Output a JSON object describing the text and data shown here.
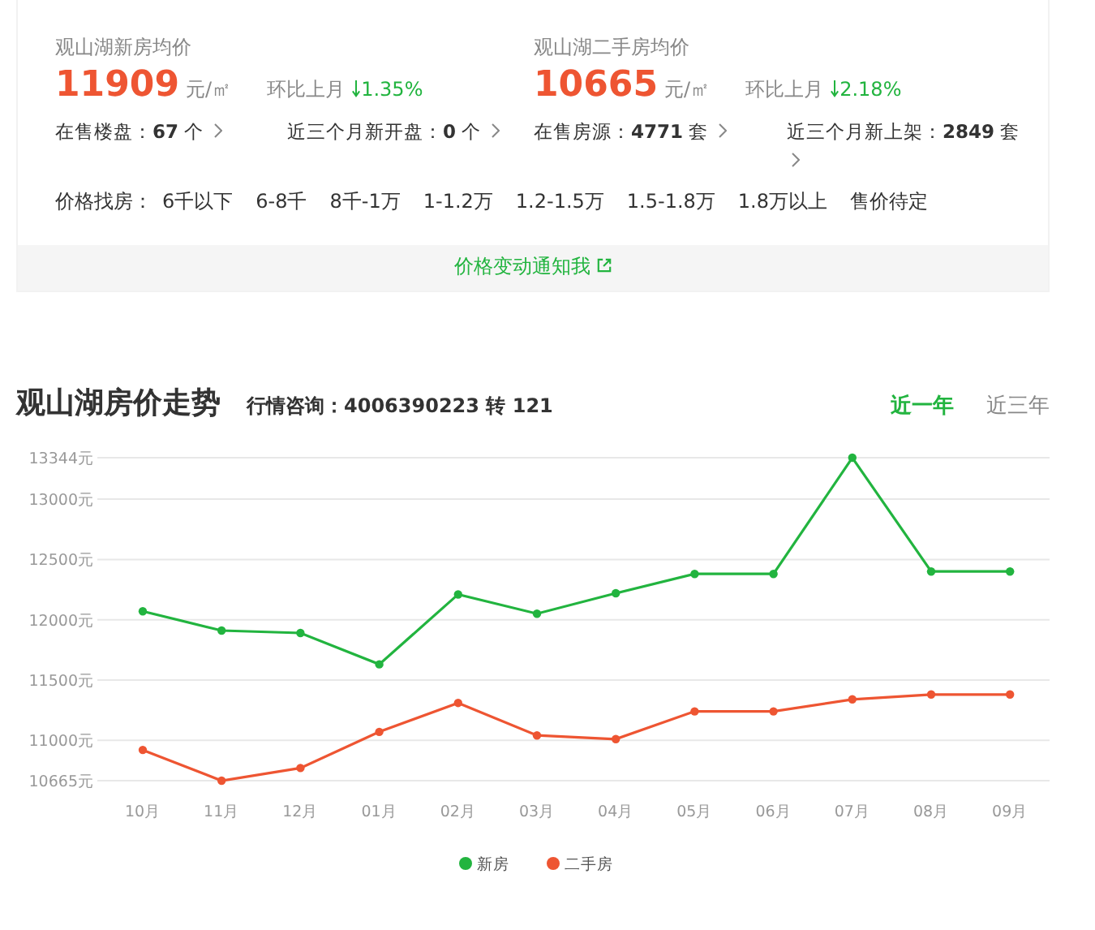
{
  "summary": [
    {
      "title": "观山湖新房均价",
      "price": "11909",
      "unit": "元/㎡",
      "change_label": "环比上月",
      "change": "1.35%",
      "falling": true,
      "stats": [
        "在售楼盘：**67** 个",
        "近三个月新开盘：**0** 个"
      ]
    },
    {
      "title": "观山湖二手房均价",
      "price": "10665",
      "unit": "元/㎡",
      "change_label": "环比上月",
      "change": "2.18%",
      "falling": true,
      "stats": [
        "在售房源：**4771** 套",
        "近三个月新上架：**2849** 套"
      ]
    }
  ],
  "price_filter": {
    "label": "价格找房：",
    "options": [
      "6千以下",
      "6-8千",
      "8千-1万",
      "1-1.2万",
      "1.2-1.5万",
      "1.5-1.8万",
      "1.8万以上",
      "售价待定"
    ]
  },
  "notify_link": "价格变动通知我",
  "trend": {
    "title": "观山湖房价走势",
    "hotline": "行情咨询：4006390223 转 121",
    "tabs": [
      {
        "label": "近一年",
        "selected": true
      },
      {
        "label": "近三年",
        "selected": false
      }
    ],
    "chart_data": {
      "type": "line",
      "categories": [
        "10月",
        "11月",
        "12月",
        "01月",
        "02月",
        "03月",
        "04月",
        "05月",
        "06月",
        "07月",
        "08月",
        "09月"
      ],
      "yticks": [
        {
          "value": 10665,
          "label": "10665元"
        },
        {
          "value": 11000,
          "label": "11000元"
        },
        {
          "value": 11500,
          "label": "11500元"
        },
        {
          "value": 12000,
          "label": "12000元"
        },
        {
          "value": 12500,
          "label": "12500元"
        },
        {
          "value": 13000,
          "label": "13000元"
        },
        {
          "value": 13344,
          "label": "13344元"
        }
      ],
      "ylim": [
        10665,
        13344
      ],
      "grid": true,
      "legend": true,
      "series": [
        {
          "name": "新房",
          "color": "#22b43f",
          "marker": true,
          "values": [
            12070,
            11910,
            11890,
            11630,
            12210,
            12050,
            12220,
            12380,
            12380,
            13344,
            12400,
            12400
          ]
        },
        {
          "name": "二手房",
          "color": "#ee5532",
          "marker": true,
          "values": [
            10920,
            10665,
            10770,
            11070,
            11310,
            11040,
            11010,
            11240,
            11240,
            11340,
            11380,
            11380
          ]
        }
      ]
    }
  }
}
